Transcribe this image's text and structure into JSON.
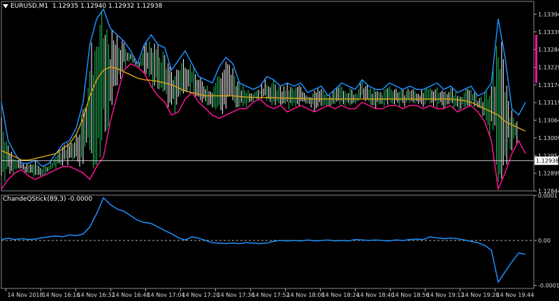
{
  "header": {
    "symbol": "EURUSD,M1",
    "quote": "1.12935 1.12940 1.12932 1.12938"
  },
  "indicator": {
    "label": "ChandeQStick(89,3) -0.0000"
  },
  "colors": {
    "background": "#000000",
    "grid": "#ffffff",
    "bull_bar": "#22c55e",
    "bear_bar": "#ffffff",
    "upper_line": "#1e90ff",
    "lower_line": "#ff1493",
    "moving_average": "#d4a017",
    "indicator_line": "#1e90ff",
    "accent_bar": "#ff1493"
  },
  "chart_data": [
    {
      "type": "line",
      "title": "",
      "y_ticks": [
        "1.13394",
        "1.13339",
        "1.13284",
        "1.13229",
        "1.13174",
        "1.13119",
        "1.13064",
        "1.13009",
        "1.12954",
        "1.12899",
        "1.12844"
      ],
      "current_price": "1.12938",
      "ylim": [
        1.12844,
        1.13434
      ],
      "series": [
        {
          "role": "upper-band",
          "x": [
            0,
            12,
            24,
            36,
            48,
            60,
            72,
            84,
            96,
            108,
            120,
            132,
            144,
            156,
            168,
            180,
            192,
            204,
            216,
            228,
            240,
            252,
            264,
            276,
            288,
            300,
            312,
            324,
            336,
            348,
            360,
            372,
            384,
            396,
            408,
            420,
            432,
            444,
            456,
            468,
            480,
            492,
            504,
            516,
            528,
            540,
            552,
            564,
            576,
            588,
            600,
            612,
            624,
            636,
            648,
            660,
            672,
            684,
            696,
            708,
            720,
            732,
            744,
            756,
            768,
            780,
            792,
            804,
            816,
            828,
            840,
            852,
            864,
            876,
            888,
            900,
            912,
            924
          ],
          "values": [
            1.1312,
            1.13,
            1.1296,
            1.1293,
            1.1293,
            1.1294,
            1.1292,
            1.1293,
            1.1296,
            1.1299,
            1.13,
            1.1304,
            1.1312,
            1.133,
            1.1338,
            1.1341,
            1.1335,
            1.1333,
            1.1331,
            1.1328,
            1.1324,
            1.133,
            1.1333,
            1.133,
            1.1329,
            1.1322,
            1.1325,
            1.1328,
            1.1324,
            1.132,
            1.1319,
            1.1318,
            1.1323,
            1.1326,
            1.1324,
            1.1318,
            1.1317,
            1.1316,
            1.1317,
            1.132,
            1.1319,
            1.1317,
            1.1318,
            1.1317,
            1.1318,
            1.1315,
            1.1316,
            1.1317,
            1.1314,
            1.1316,
            1.1318,
            1.1317,
            1.1316,
            1.1319,
            1.1317,
            1.1316,
            1.1316,
            1.1318,
            1.1317,
            1.1316,
            1.1317,
            1.1316,
            1.1316,
            1.1317,
            1.1318,
            1.1316,
            1.1317,
            1.1315,
            1.1316,
            1.1317,
            1.1314,
            1.1315,
            1.1318,
            1.1338,
            1.1326,
            1.131,
            1.1308,
            1.1312
          ]
        },
        {
          "role": "lower-band",
          "x": [
            0,
            12,
            24,
            36,
            48,
            60,
            72,
            84,
            96,
            108,
            120,
            132,
            144,
            156,
            168,
            180,
            192,
            204,
            216,
            228,
            240,
            252,
            264,
            276,
            288,
            300,
            312,
            324,
            336,
            348,
            360,
            372,
            384,
            396,
            408,
            420,
            432,
            444,
            456,
            468,
            480,
            492,
            504,
            516,
            528,
            540,
            552,
            564,
            576,
            588,
            600,
            612,
            624,
            636,
            648,
            660,
            672,
            684,
            696,
            708,
            720,
            732,
            744,
            756,
            768,
            780,
            792,
            804,
            816,
            828,
            840,
            852,
            864,
            876,
            888,
            900,
            912,
            924
          ],
          "values": [
            1.1285,
            1.1288,
            1.129,
            1.1291,
            1.1289,
            1.1288,
            1.1289,
            1.129,
            1.1291,
            1.1292,
            1.1292,
            1.1291,
            1.129,
            1.1288,
            1.1292,
            1.1295,
            1.1306,
            1.1314,
            1.1322,
            1.1324,
            1.1323,
            1.1321,
            1.1317,
            1.1314,
            1.1312,
            1.1308,
            1.1309,
            1.1313,
            1.1315,
            1.1312,
            1.131,
            1.1308,
            1.1307,
            1.1308,
            1.1309,
            1.131,
            1.131,
            1.1312,
            1.1313,
            1.1311,
            1.131,
            1.1311,
            1.1309,
            1.131,
            1.1311,
            1.131,
            1.1309,
            1.131,
            1.1311,
            1.131,
            1.1311,
            1.131,
            1.131,
            1.1312,
            1.1311,
            1.131,
            1.131,
            1.1311,
            1.1311,
            1.131,
            1.1311,
            1.1311,
            1.131,
            1.1311,
            1.131,
            1.131,
            1.1311,
            1.1309,
            1.131,
            1.1311,
            1.1309,
            1.1306,
            1.13,
            1.1285,
            1.129,
            1.1296,
            1.13,
            1.1296
          ]
        },
        {
          "role": "moving-average",
          "x": [
            0,
            12,
            24,
            36,
            48,
            60,
            72,
            84,
            96,
            108,
            120,
            132,
            144,
            156,
            168,
            180,
            192,
            204,
            216,
            228,
            240,
            252,
            264,
            276,
            288,
            300,
            312,
            324,
            336,
            348,
            360,
            372,
            384,
            396,
            408,
            420,
            432,
            444,
            456,
            468,
            480,
            492,
            504,
            516,
            528,
            540,
            552,
            564,
            576,
            588,
            600,
            612,
            624,
            636,
            648,
            660,
            672,
            684,
            696,
            708,
            720,
            732,
            744,
            756,
            768,
            780,
            792,
            804,
            816,
            828,
            840,
            852,
            864,
            876,
            888,
            900,
            912,
            924
          ],
          "values": [
            1.1297,
            1.1296,
            1.1295,
            1.1294,
            1.1294,
            1.12945,
            1.1295,
            1.12955,
            1.1296,
            1.12975,
            1.1299,
            1.1302,
            1.1307,
            1.1314,
            1.1319,
            1.1322,
            1.1323,
            1.13225,
            1.13215,
            1.13205,
            1.13195,
            1.1319,
            1.13188,
            1.13185,
            1.1318,
            1.13175,
            1.13165,
            1.13155,
            1.1315,
            1.13145,
            1.1314,
            1.1314,
            1.1314,
            1.1314,
            1.1314,
            1.13138,
            1.13136,
            1.13135,
            1.13135,
            1.13134,
            1.13134,
            1.13133,
            1.13133,
            1.13132,
            1.13132,
            1.13131,
            1.1313,
            1.1313,
            1.1313,
            1.1313,
            1.1313,
            1.1313,
            1.1313,
            1.1313,
            1.1313,
            1.1313,
            1.1313,
            1.1313,
            1.1313,
            1.1313,
            1.1313,
            1.1313,
            1.1313,
            1.1313,
            1.1313,
            1.1313,
            1.1313,
            1.13128,
            1.13125,
            1.1312,
            1.1311,
            1.131,
            1.1309,
            1.1308,
            1.1306,
            1.1305,
            1.1304,
            1.1303
          ]
        }
      ]
    },
    {
      "type": "line",
      "title": "",
      "y_ticks": [
        "0.0001",
        "0.00",
        "-0.0001"
      ],
      "ylim": [
        -0.000107,
        0.000101
      ],
      "series": [
        {
          "role": "quickstick",
          "x": [
            0,
            12,
            24,
            36,
            48,
            60,
            72,
            84,
            96,
            108,
            120,
            132,
            144,
            156,
            168,
            180,
            192,
            204,
            216,
            228,
            240,
            252,
            264,
            276,
            288,
            300,
            312,
            324,
            336,
            348,
            360,
            372,
            384,
            396,
            408,
            420,
            432,
            444,
            456,
            468,
            480,
            492,
            504,
            516,
            528,
            540,
            552,
            564,
            576,
            588,
            600,
            612,
            624,
            636,
            648,
            660,
            672,
            684,
            696,
            708,
            720,
            732,
            744,
            756,
            768,
            780,
            792,
            804,
            816,
            828,
            840,
            852,
            864,
            876,
            888,
            900,
            912,
            924
          ],
          "values": [
            2e-06,
            5e-06,
            2e-06,
            4e-06,
            2e-06,
            3e-06,
            6e-06,
            8e-06,
            1e-05,
            8e-06,
            1.2e-05,
            1.1e-05,
            1.4e-05,
            3e-05,
            6e-05,
            9.5e-05,
            8e-05,
            7e-05,
            6.5e-05,
            5.5e-05,
            4.5e-05,
            4e-05,
            3.8e-05,
            3e-05,
            2.2e-05,
            1.5e-05,
            6e-06,
            1e-06,
            8e-06,
            5e-06,
            0.0,
            -5e-06,
            -6e-06,
            -7e-06,
            -6e-06,
            -7e-06,
            -5e-06,
            -6e-06,
            -7e-06,
            -6e-06,
            -2e-06,
            0.0,
            -1e-06,
            0.0,
            -1e-06,
            1e-06,
            -1e-06,
            0.0,
            1e-06,
            -1e-06,
            0.0,
            -1e-06,
            2e-06,
            1e-06,
            0.0,
            1e-06,
            0.0,
            -1e-06,
            1e-06,
            0.0,
            2e-06,
            3e-06,
            2e-06,
            8e-06,
            6e-06,
            4e-06,
            5e-06,
            4e-06,
            1e-06,
            -2e-06,
            -5e-06,
            -1.1e-05,
            -2.2e-05,
            -9.3e-05,
            -7e-05,
            -4.8e-05,
            -2.8e-05,
            -3.1e-05
          ]
        }
      ]
    }
  ],
  "time_axis": [
    "14 Nov 2018",
    "14 Nov 16:16",
    "14 Nov 16:32",
    "14 Nov 16:48",
    "14 Nov 17:04",
    "14 Nov 17:20",
    "14 Nov 17:36",
    "14 Nov 17:52",
    "14 Nov 18:08",
    "14 Nov 18:24",
    "14 Nov 18:40",
    "14 Nov 18:56",
    "14 Nov 19:12",
    "14 Nov 19:28",
    "14 Nov 19:44"
  ]
}
